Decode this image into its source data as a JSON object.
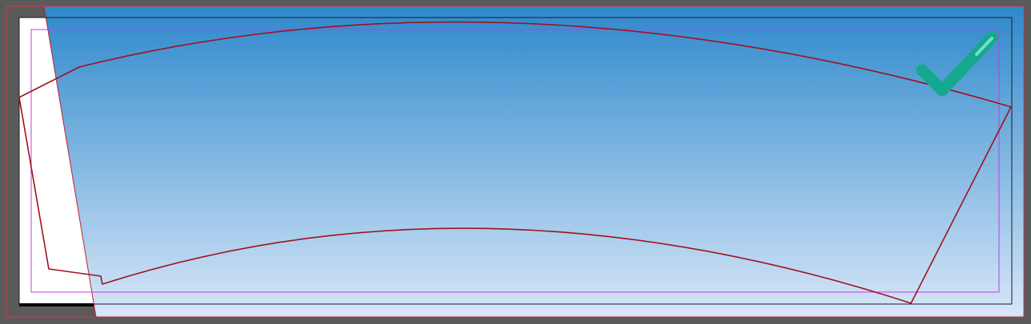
{
  "app": {
    "workspace_background": "#5a5a5a"
  },
  "artboard": {
    "paper_color": "#ffffff",
    "gradient_top": "#2e88cc",
    "gradient_bottom": "#d7e7f8",
    "bleed_color": "#d23b48",
    "margin_color": "#c23ce6",
    "trim_color": "#1c1c1c",
    "dieline_color": "#a0121c"
  },
  "status_indicator": {
    "icon": "checkmark-icon",
    "color": "#16a88e",
    "highlight_color": "#6fe0c8",
    "state": "approved"
  }
}
